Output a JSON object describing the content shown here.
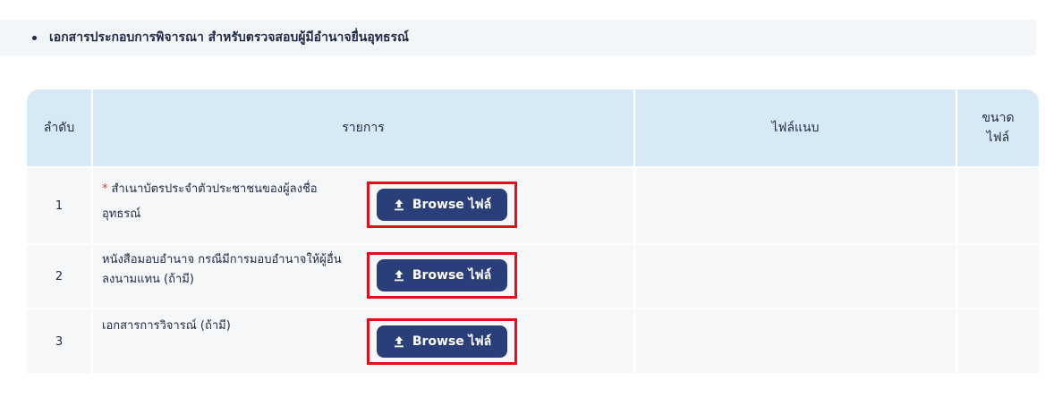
{
  "section": {
    "title": "เอกสารประกอบการพิจารณา สำหรับตรวจสอบผู้มีอำนาจยื่นอุทธรณ์"
  },
  "table": {
    "headers": {
      "index": "ลำดับ",
      "item": "รายการ",
      "file": "ไฟล์แนบ",
      "size_line1": "ขนาด",
      "size_line2": "ไฟล์"
    },
    "rows": [
      {
        "index": "1",
        "required_mark": "*",
        "label": "สำเนาบัตรประจำตัวประชาชนของผู้ลงชื่ออุทธรณ์",
        "button_label": "Browse ไฟล์"
      },
      {
        "index": "2",
        "required_mark": "",
        "label": "หนังสือมอบอำนาจ กรณีมีการมอบอำนาจให้ผู้อื่นลงนามแทน (ถ้ามี)",
        "button_label": "Browse ไฟล์"
      },
      {
        "index": "3",
        "required_mark": "",
        "label": "เอกสารการวิจารณ์ (ถ้ามี)",
        "button_label": "Browse ไฟล์"
      }
    ]
  },
  "icons": {
    "bullet": "bullet-icon",
    "upload": "upload-icon"
  },
  "colors": {
    "header_bg": "#d7e9f4",
    "row_bg": "#f5f7f9",
    "button_bg": "#2a3f7a",
    "button_outline": "#e0101a",
    "required": "#e53935"
  }
}
